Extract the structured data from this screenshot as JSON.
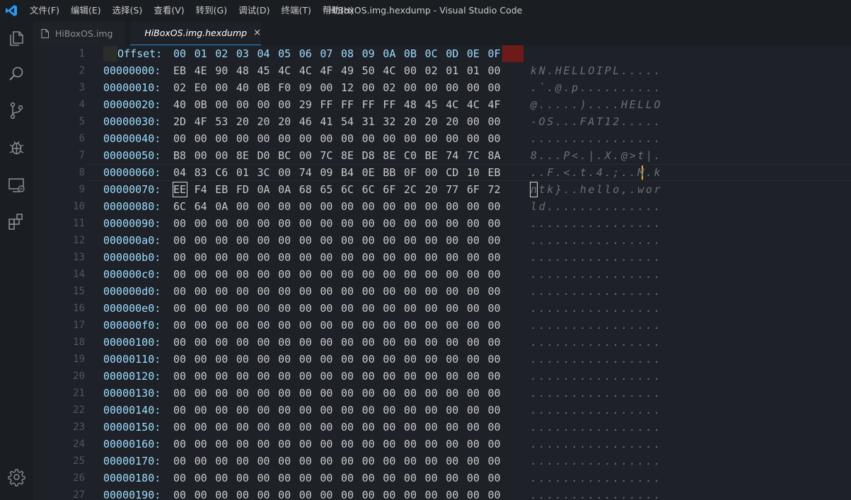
{
  "titlebar": {
    "menu": [
      "文件(F)",
      "编辑(E)",
      "选择(S)",
      "查看(V)",
      "转到(G)",
      "调试(D)",
      "终端(T)",
      "帮助(H)"
    ],
    "window_title": "HiBoxOS.img.hexdump - Visual Studio Code"
  },
  "activitybar": {
    "icons": [
      "explorer-icon",
      "search-icon",
      "source-control-icon",
      "debug-icon",
      "remote-explorer-icon",
      "extensions-icon",
      "settings-gear-icon"
    ]
  },
  "tabs": [
    {
      "label": "HiBoxOS.img",
      "active": false
    },
    {
      "label": "HiBoxOS.img.hexdump",
      "active": true,
      "close": "×"
    }
  ],
  "colors": {
    "accent": "#2b88d8",
    "offset": "#9cdcfe",
    "hex": "#c9c9c9",
    "ascii": "#6a6f78",
    "caret": "#e8b23b",
    "header_highlight": "#6e1a1a"
  },
  "hexdump": {
    "header": {
      "line": "1",
      "label": "Offset:",
      "columns": [
        "00",
        "01",
        "02",
        "03",
        "04",
        "05",
        "06",
        "07",
        "08",
        "09",
        "0A",
        "0B",
        "0C",
        "0D",
        "0E",
        "0F"
      ]
    },
    "rows": [
      {
        "line": "2",
        "offset": "00000000:",
        "bytes": [
          "EB",
          "4E",
          "90",
          "48",
          "45",
          "4C",
          "4C",
          "4F",
          "49",
          "50",
          "4C",
          "00",
          "02",
          "01",
          "01",
          "00"
        ],
        "ascii": "kN.HELLOIPL....."
      },
      {
        "line": "3",
        "offset": "00000010:",
        "bytes": [
          "02",
          "E0",
          "00",
          "40",
          "0B",
          "F0",
          "09",
          "00",
          "12",
          "00",
          "02",
          "00",
          "00",
          "00",
          "00",
          "00"
        ],
        "ascii": ".`.@.p.........."
      },
      {
        "line": "4",
        "offset": "00000020:",
        "bytes": [
          "40",
          "0B",
          "00",
          "00",
          "00",
          "00",
          "29",
          "FF",
          "FF",
          "FF",
          "FF",
          "48",
          "45",
          "4C",
          "4C",
          "4F"
        ],
        "ascii": "@.....)....HELLO"
      },
      {
        "line": "5",
        "offset": "00000030:",
        "bytes": [
          "2D",
          "4F",
          "53",
          "20",
          "20",
          "20",
          "46",
          "41",
          "54",
          "31",
          "32",
          "20",
          "20",
          "20",
          "00",
          "00"
        ],
        "ascii": "-OS...FAT12....."
      },
      {
        "line": "6",
        "offset": "00000040:",
        "bytes": [
          "00",
          "00",
          "00",
          "00",
          "00",
          "00",
          "00",
          "00",
          "00",
          "00",
          "00",
          "00",
          "00",
          "00",
          "00",
          "00"
        ],
        "ascii": "................"
      },
      {
        "line": "7",
        "offset": "00000050:",
        "bytes": [
          "B8",
          "00",
          "00",
          "8E",
          "D0",
          "BC",
          "00",
          "7C",
          "8E",
          "D8",
          "8E",
          "C0",
          "BE",
          "74",
          "7C",
          "8A"
        ],
        "ascii": "8...P<.|.X.@>t|."
      },
      {
        "line": "8",
        "offset": "00000060:",
        "bytes": [
          "04",
          "83",
          "C6",
          "01",
          "3C",
          "00",
          "74",
          "09",
          "B4",
          "0E",
          "BB",
          "0F",
          "00",
          "CD",
          "10",
          "EB"
        ],
        "ascii": "..F.<.t.4.;..M.k"
      },
      {
        "line": "9",
        "offset": "00000070:",
        "bytes": [
          "EE",
          "F4",
          "EB",
          "FD",
          "0A",
          "0A",
          "68",
          "65",
          "6C",
          "6C",
          "6F",
          "2C",
          "20",
          "77",
          "6F",
          "72"
        ],
        "ascii": "ntk}..hello,.wor"
      },
      {
        "line": "10",
        "offset": "00000080:",
        "bytes": [
          "6C",
          "64",
          "0A",
          "00",
          "00",
          "00",
          "00",
          "00",
          "00",
          "00",
          "00",
          "00",
          "00",
          "00",
          "00",
          "00"
        ],
        "ascii": "ld.............."
      },
      {
        "line": "11",
        "offset": "00000090:",
        "bytes": [
          "00",
          "00",
          "00",
          "00",
          "00",
          "00",
          "00",
          "00",
          "00",
          "00",
          "00",
          "00",
          "00",
          "00",
          "00",
          "00"
        ],
        "ascii": "................"
      },
      {
        "line": "12",
        "offset": "000000a0:",
        "bytes": [
          "00",
          "00",
          "00",
          "00",
          "00",
          "00",
          "00",
          "00",
          "00",
          "00",
          "00",
          "00",
          "00",
          "00",
          "00",
          "00"
        ],
        "ascii": "................"
      },
      {
        "line": "13",
        "offset": "000000b0:",
        "bytes": [
          "00",
          "00",
          "00",
          "00",
          "00",
          "00",
          "00",
          "00",
          "00",
          "00",
          "00",
          "00",
          "00",
          "00",
          "00",
          "00"
        ],
        "ascii": "................"
      },
      {
        "line": "14",
        "offset": "000000c0:",
        "bytes": [
          "00",
          "00",
          "00",
          "00",
          "00",
          "00",
          "00",
          "00",
          "00",
          "00",
          "00",
          "00",
          "00",
          "00",
          "00",
          "00"
        ],
        "ascii": "................"
      },
      {
        "line": "15",
        "offset": "000000d0:",
        "bytes": [
          "00",
          "00",
          "00",
          "00",
          "00",
          "00",
          "00",
          "00",
          "00",
          "00",
          "00",
          "00",
          "00",
          "00",
          "00",
          "00"
        ],
        "ascii": "................"
      },
      {
        "line": "16",
        "offset": "000000e0:",
        "bytes": [
          "00",
          "00",
          "00",
          "00",
          "00",
          "00",
          "00",
          "00",
          "00",
          "00",
          "00",
          "00",
          "00",
          "00",
          "00",
          "00"
        ],
        "ascii": "................"
      },
      {
        "line": "17",
        "offset": "000000f0:",
        "bytes": [
          "00",
          "00",
          "00",
          "00",
          "00",
          "00",
          "00",
          "00",
          "00",
          "00",
          "00",
          "00",
          "00",
          "00",
          "00",
          "00"
        ],
        "ascii": "................"
      },
      {
        "line": "18",
        "offset": "00000100:",
        "bytes": [
          "00",
          "00",
          "00",
          "00",
          "00",
          "00",
          "00",
          "00",
          "00",
          "00",
          "00",
          "00",
          "00",
          "00",
          "00",
          "00"
        ],
        "ascii": "................"
      },
      {
        "line": "19",
        "offset": "00000110:",
        "bytes": [
          "00",
          "00",
          "00",
          "00",
          "00",
          "00",
          "00",
          "00",
          "00",
          "00",
          "00",
          "00",
          "00",
          "00",
          "00",
          "00"
        ],
        "ascii": "................"
      },
      {
        "line": "20",
        "offset": "00000120:",
        "bytes": [
          "00",
          "00",
          "00",
          "00",
          "00",
          "00",
          "00",
          "00",
          "00",
          "00",
          "00",
          "00",
          "00",
          "00",
          "00",
          "00"
        ],
        "ascii": "................"
      },
      {
        "line": "21",
        "offset": "00000130:",
        "bytes": [
          "00",
          "00",
          "00",
          "00",
          "00",
          "00",
          "00",
          "00",
          "00",
          "00",
          "00",
          "00",
          "00",
          "00",
          "00",
          "00"
        ],
        "ascii": "................"
      },
      {
        "line": "22",
        "offset": "00000140:",
        "bytes": [
          "00",
          "00",
          "00",
          "00",
          "00",
          "00",
          "00",
          "00",
          "00",
          "00",
          "00",
          "00",
          "00",
          "00",
          "00",
          "00"
        ],
        "ascii": "................"
      },
      {
        "line": "23",
        "offset": "00000150:",
        "bytes": [
          "00",
          "00",
          "00",
          "00",
          "00",
          "00",
          "00",
          "00",
          "00",
          "00",
          "00",
          "00",
          "00",
          "00",
          "00",
          "00"
        ],
        "ascii": "................"
      },
      {
        "line": "24",
        "offset": "00000160:",
        "bytes": [
          "00",
          "00",
          "00",
          "00",
          "00",
          "00",
          "00",
          "00",
          "00",
          "00",
          "00",
          "00",
          "00",
          "00",
          "00",
          "00"
        ],
        "ascii": "................"
      },
      {
        "line": "25",
        "offset": "00000170:",
        "bytes": [
          "00",
          "00",
          "00",
          "00",
          "00",
          "00",
          "00",
          "00",
          "00",
          "00",
          "00",
          "00",
          "00",
          "00",
          "00",
          "00"
        ],
        "ascii": "................"
      },
      {
        "line": "26",
        "offset": "00000180:",
        "bytes": [
          "00",
          "00",
          "00",
          "00",
          "00",
          "00",
          "00",
          "00",
          "00",
          "00",
          "00",
          "00",
          "00",
          "00",
          "00",
          "00"
        ],
        "ascii": "................"
      },
      {
        "line": "27",
        "offset": "00000190:",
        "bytes": [
          "00",
          "00",
          "00",
          "00",
          "00",
          "00",
          "00",
          "00",
          "00",
          "00",
          "00",
          "00",
          "00",
          "00",
          "00",
          "00"
        ],
        "ascii": "................"
      }
    ]
  }
}
